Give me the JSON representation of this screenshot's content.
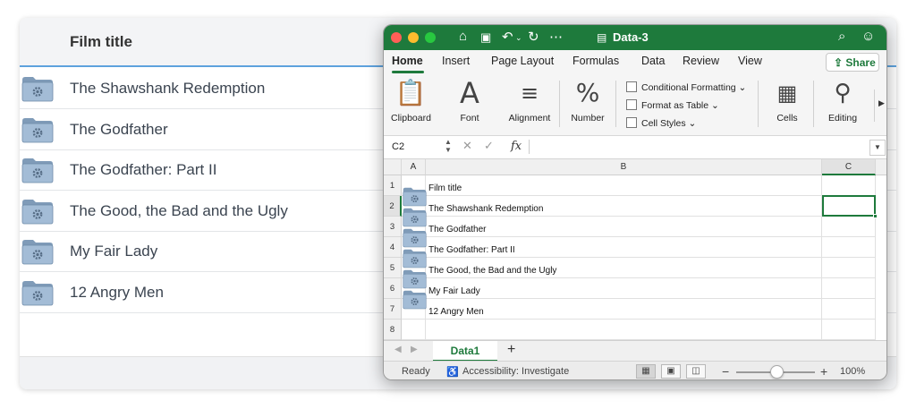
{
  "background_app": {
    "header_title": "Film title",
    "rows": [
      {
        "title": "The Shawshank Redemption"
      },
      {
        "title": "The Godfather"
      },
      {
        "title": "The Godfather: Part II"
      },
      {
        "title": "The Good, the Bad and the Ugly"
      },
      {
        "title": "My Fair Lady"
      },
      {
        "title": "12 Angry Men"
      }
    ]
  },
  "excel": {
    "window_title": "Data-3",
    "ribbon_tabs": [
      "Home",
      "Insert",
      "Page Layout",
      "Formulas",
      "Data",
      "Review",
      "View"
    ],
    "share_label": "Share",
    "groups": {
      "clipboard": "Clipboard",
      "font": "Font",
      "alignment": "Alignment",
      "number": "Number",
      "conditional_formatting": "Conditional Formatting",
      "format_as_table": "Format as Table",
      "cell_styles": "Cell Styles",
      "cells": "Cells",
      "editing": "Editing"
    },
    "name_box": "C2",
    "fx_label": "fx",
    "formula_value": "",
    "columns": [
      "A",
      "B",
      "C"
    ],
    "rows": [
      {
        "num": "1",
        "b": "Film title",
        "has_image": false
      },
      {
        "num": "2",
        "b": "The Shawshank Redemption",
        "has_image": true
      },
      {
        "num": "3",
        "b": "The Godfather",
        "has_image": true
      },
      {
        "num": "4",
        "b": "The Godfather: Part II",
        "has_image": true
      },
      {
        "num": "5",
        "b": "The Good, the Bad and the Ugly",
        "has_image": true
      },
      {
        "num": "6",
        "b": "My Fair Lady",
        "has_image": true
      },
      {
        "num": "7",
        "b": "12 Angry Men",
        "has_image": true
      },
      {
        "num": "8",
        "b": "",
        "has_image": false
      }
    ],
    "sheet_tab": "Data1",
    "add_sheet": "+",
    "status": {
      "ready": "Ready",
      "accessibility": "Accessibility: Investigate",
      "zoom_minus": "−",
      "zoom_plus": "+",
      "zoom": "100%"
    }
  },
  "colors": {
    "excel_green": "#1e7a3c",
    "header_accent": "#5ea2dd"
  }
}
